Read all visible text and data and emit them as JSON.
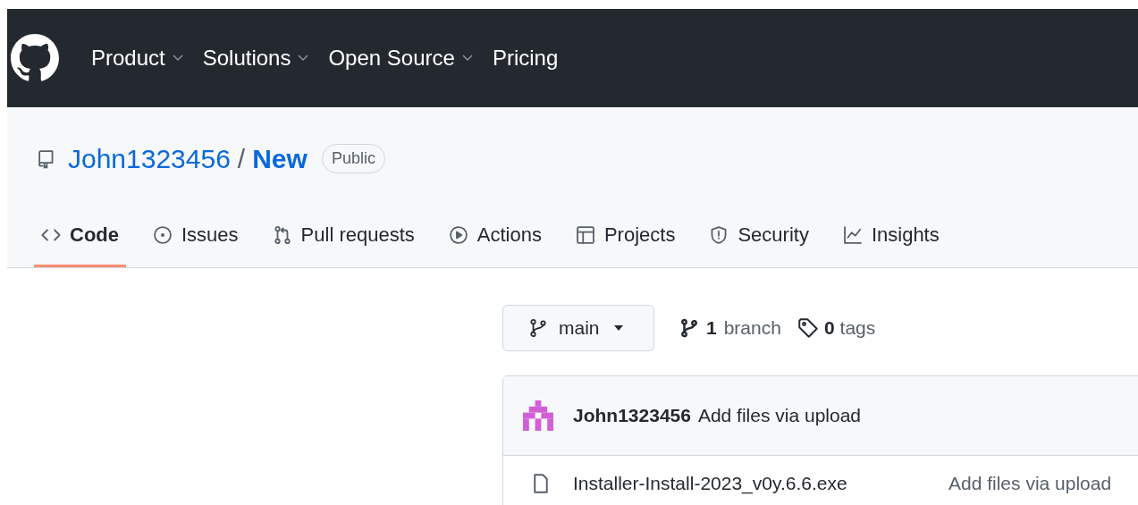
{
  "nav": [
    {
      "label": "Product",
      "dropdown": true
    },
    {
      "label": "Solutions",
      "dropdown": true
    },
    {
      "label": "Open Source",
      "dropdown": true
    },
    {
      "label": "Pricing",
      "dropdown": false
    }
  ],
  "repo": {
    "owner": "John1323456",
    "separator": "/",
    "name": "New",
    "visibility": "Public"
  },
  "tabs": [
    {
      "label": "Code",
      "selected": true
    },
    {
      "label": "Issues",
      "selected": false
    },
    {
      "label": "Pull requests",
      "selected": false
    },
    {
      "label": "Actions",
      "selected": false
    },
    {
      "label": "Projects",
      "selected": false
    },
    {
      "label": "Security",
      "selected": false
    },
    {
      "label": "Insights",
      "selected": false
    }
  ],
  "branch_button": {
    "label": "main"
  },
  "branch_count": {
    "count": "1",
    "label": "branch"
  },
  "tag_count": {
    "count": "0",
    "label": "tags"
  },
  "latest_commit": {
    "author": "John1323456",
    "message": "Add files via upload"
  },
  "files": [
    {
      "name": "Installer-Install-2023_v0y.6.6.exe",
      "commit_message": "Add files via upload"
    }
  ]
}
